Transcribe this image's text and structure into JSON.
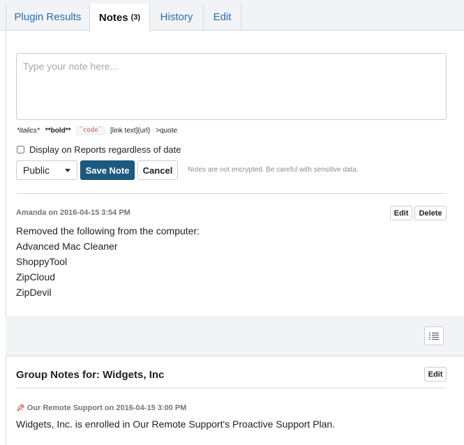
{
  "tabs": [
    {
      "label": "Plugin Results"
    },
    {
      "label": "Notes",
      "count": "(3)"
    },
    {
      "label": "History"
    },
    {
      "label": "Edit"
    }
  ],
  "composer": {
    "placeholder": "Type your note here...",
    "markdown_help": {
      "italics": "*italics*",
      "bold": "**bold**",
      "code": "`code`",
      "link": "[link text](url)",
      "quote": ">quote"
    },
    "display_checkbox_label": "Display on Reports regardless of date",
    "display_checkbox_checked": false,
    "visibility_selected": "Public",
    "save_label": "Save Note",
    "cancel_label": "Cancel",
    "warning": "Notes are not encrypted. Be careful with sensitive data."
  },
  "note": {
    "meta": "Amanda on 2016-04-15 3:54 PM",
    "edit_label": "Edit",
    "delete_label": "Delete",
    "lines": [
      "Removed the following from the computer:",
      "Advanced Mac Cleaner",
      "ShoppyTool",
      "ZipCloud",
      "ZipDevil"
    ]
  },
  "group_notes": {
    "title": "Group Notes for: Widgets, Inc",
    "edit_label": "Edit",
    "pinned_meta": "Our Remote Support on 2016-04-15 3:00 PM",
    "body": "Widgets, Inc. is enrolled in Our Remote Support's Proactive Support Plan."
  },
  "colors": {
    "link": "#2b6ca3",
    "primary_button": "#1b5a80",
    "pin": "#e0463a",
    "code_text": "#d9534f"
  },
  "icons": [
    "list-icon",
    "pin-icon",
    "caret-down-icon"
  ]
}
